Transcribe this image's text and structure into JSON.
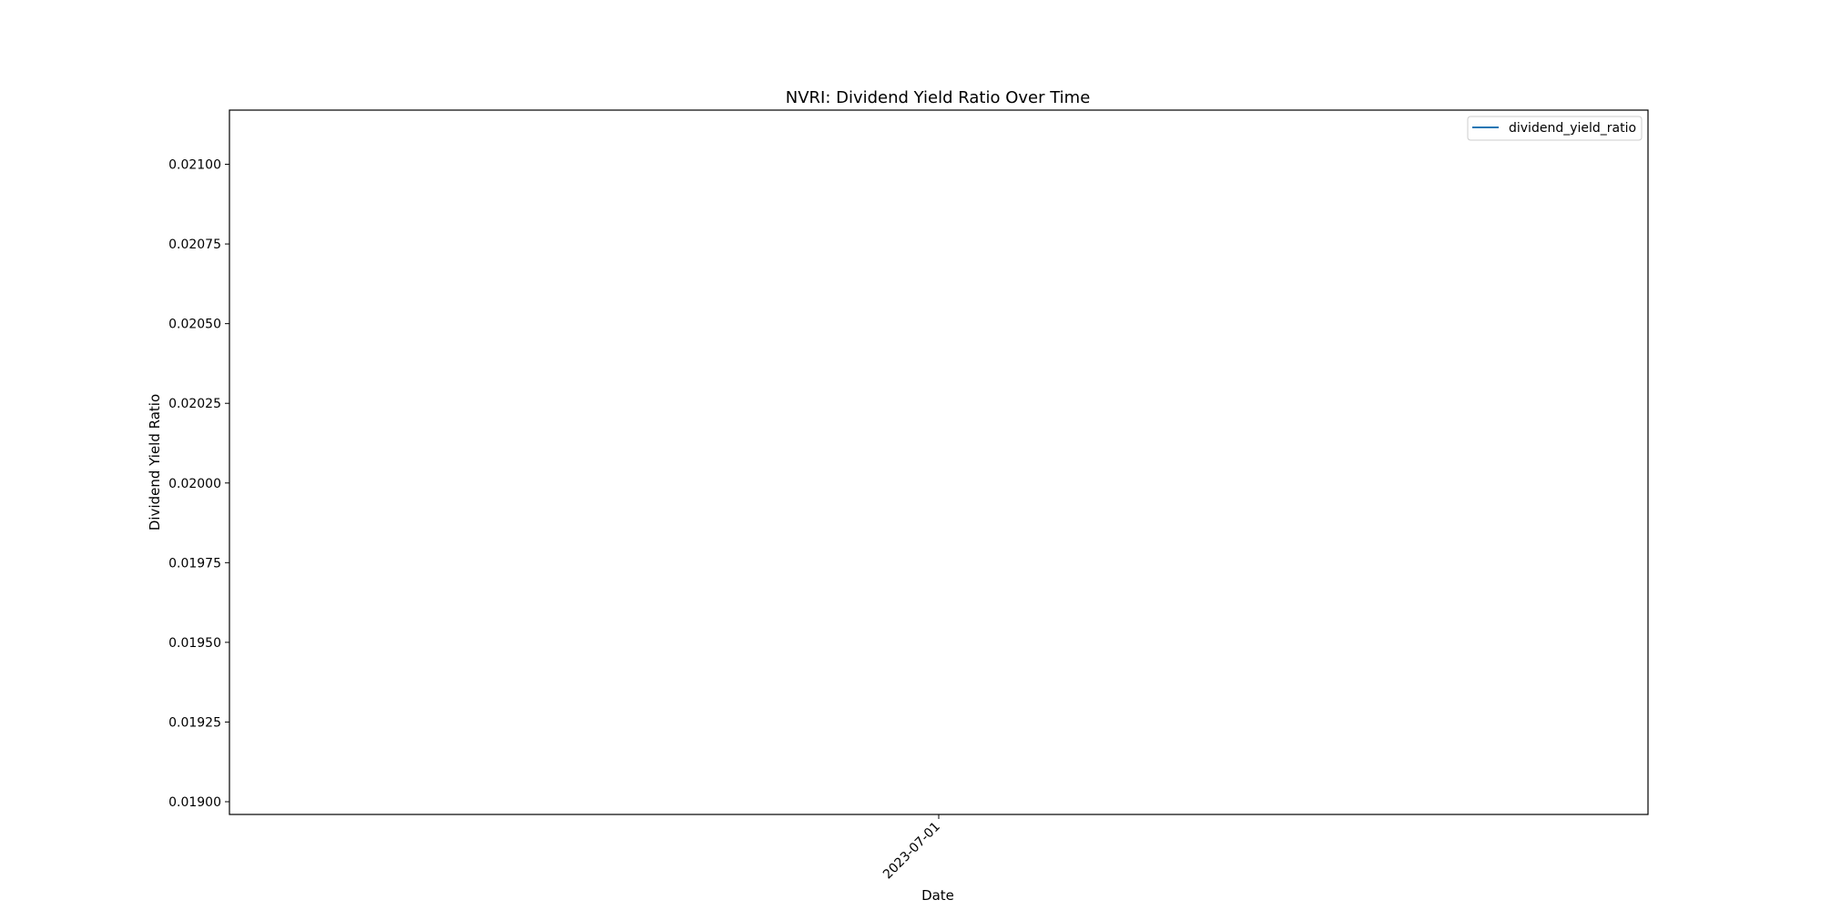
{
  "chart_data": {
    "type": "line",
    "title": "NVRI: Dividend Yield Ratio Over Time",
    "xlabel": "Date",
    "ylabel": "Dividend Yield Ratio",
    "ylim": [
      0.01896,
      0.02117
    ],
    "y_ticks": [
      0.019,
      0.01925,
      0.0195,
      0.01975,
      0.02,
      0.02025,
      0.0205,
      0.02075,
      0.021
    ],
    "y_tick_labels": [
      "0.01900",
      "0.01925",
      "0.01950",
      "0.01975",
      "0.02000",
      "0.02025",
      "0.02050",
      "0.02075",
      "0.02100"
    ],
    "x_ticks": [
      "2023-07-01"
    ],
    "grid": false,
    "legend_position": "upper right",
    "series": [
      {
        "name": "dividend_yield_ratio",
        "color": "#1f77b4",
        "x": [],
        "values": []
      }
    ]
  }
}
